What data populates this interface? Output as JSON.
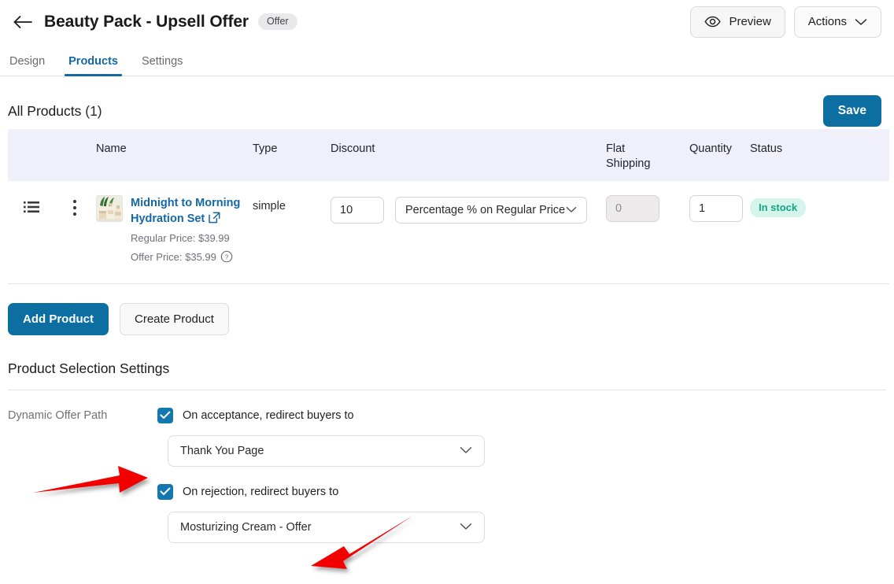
{
  "header": {
    "back_icon": "arrow-left-icon",
    "title": "Beauty Pack - Upsell Offer",
    "badge": "Offer",
    "preview_label": "Preview",
    "preview_icon": "eye-icon",
    "actions_label": "Actions",
    "actions_icon": "chevron-down-icon"
  },
  "tabs": [
    {
      "label": "Design",
      "active": false
    },
    {
      "label": "Products",
      "active": true
    },
    {
      "label": "Settings",
      "active": false
    }
  ],
  "products_section": {
    "title": "All Products",
    "count": "(1)",
    "save_label": "Save"
  },
  "table": {
    "columns": [
      "",
      "",
      "Name",
      "Type",
      "Discount",
      "Flat Shipping",
      "Quantity",
      "Status"
    ],
    "column_flat_shipping_line1": "Flat",
    "column_flat_shipping_line2": "Shipping",
    "rows": [
      {
        "drag_icon": "list-handle-icon",
        "kebab_icon": "more-vertical-icon",
        "thumbnail_icon": "product-thumbnail",
        "name": "Midnight to Morning Hydration Set",
        "external_link_icon": "external-link-icon",
        "regular_price": "Regular Price: $39.99",
        "offer_price": "Offer Price: $35.99",
        "help_icon": "help-circle-icon",
        "type": "simple",
        "discount_value": "10",
        "discount_type": "Percentage % on Regular Price",
        "flat_shipping": "0",
        "quantity": "1",
        "status": "In stock"
      }
    ]
  },
  "actions": {
    "add_product_label": "Add Product",
    "create_product_label": "Create Product"
  },
  "settings": {
    "title": "Product Selection Settings",
    "dynamic_offer_path_label": "Dynamic Offer Path",
    "acceptance_checkbox_label": "On acceptance, redirect buyers to",
    "acceptance_value": "Thank You Page",
    "rejection_checkbox_label": "On rejection, redirect buyers to",
    "rejection_value": "Mosturizing Cream - Offer"
  },
  "colors": {
    "accent_blue": "#1667a4",
    "primary_button": "#0d6ea2",
    "checkbox_blue": "#1477ad",
    "table_header_bg": "#eff0fa",
    "stock_badge_bg": "#d5f5ec",
    "stock_badge_text": "#11a683",
    "annotation_red": "#f20000"
  }
}
